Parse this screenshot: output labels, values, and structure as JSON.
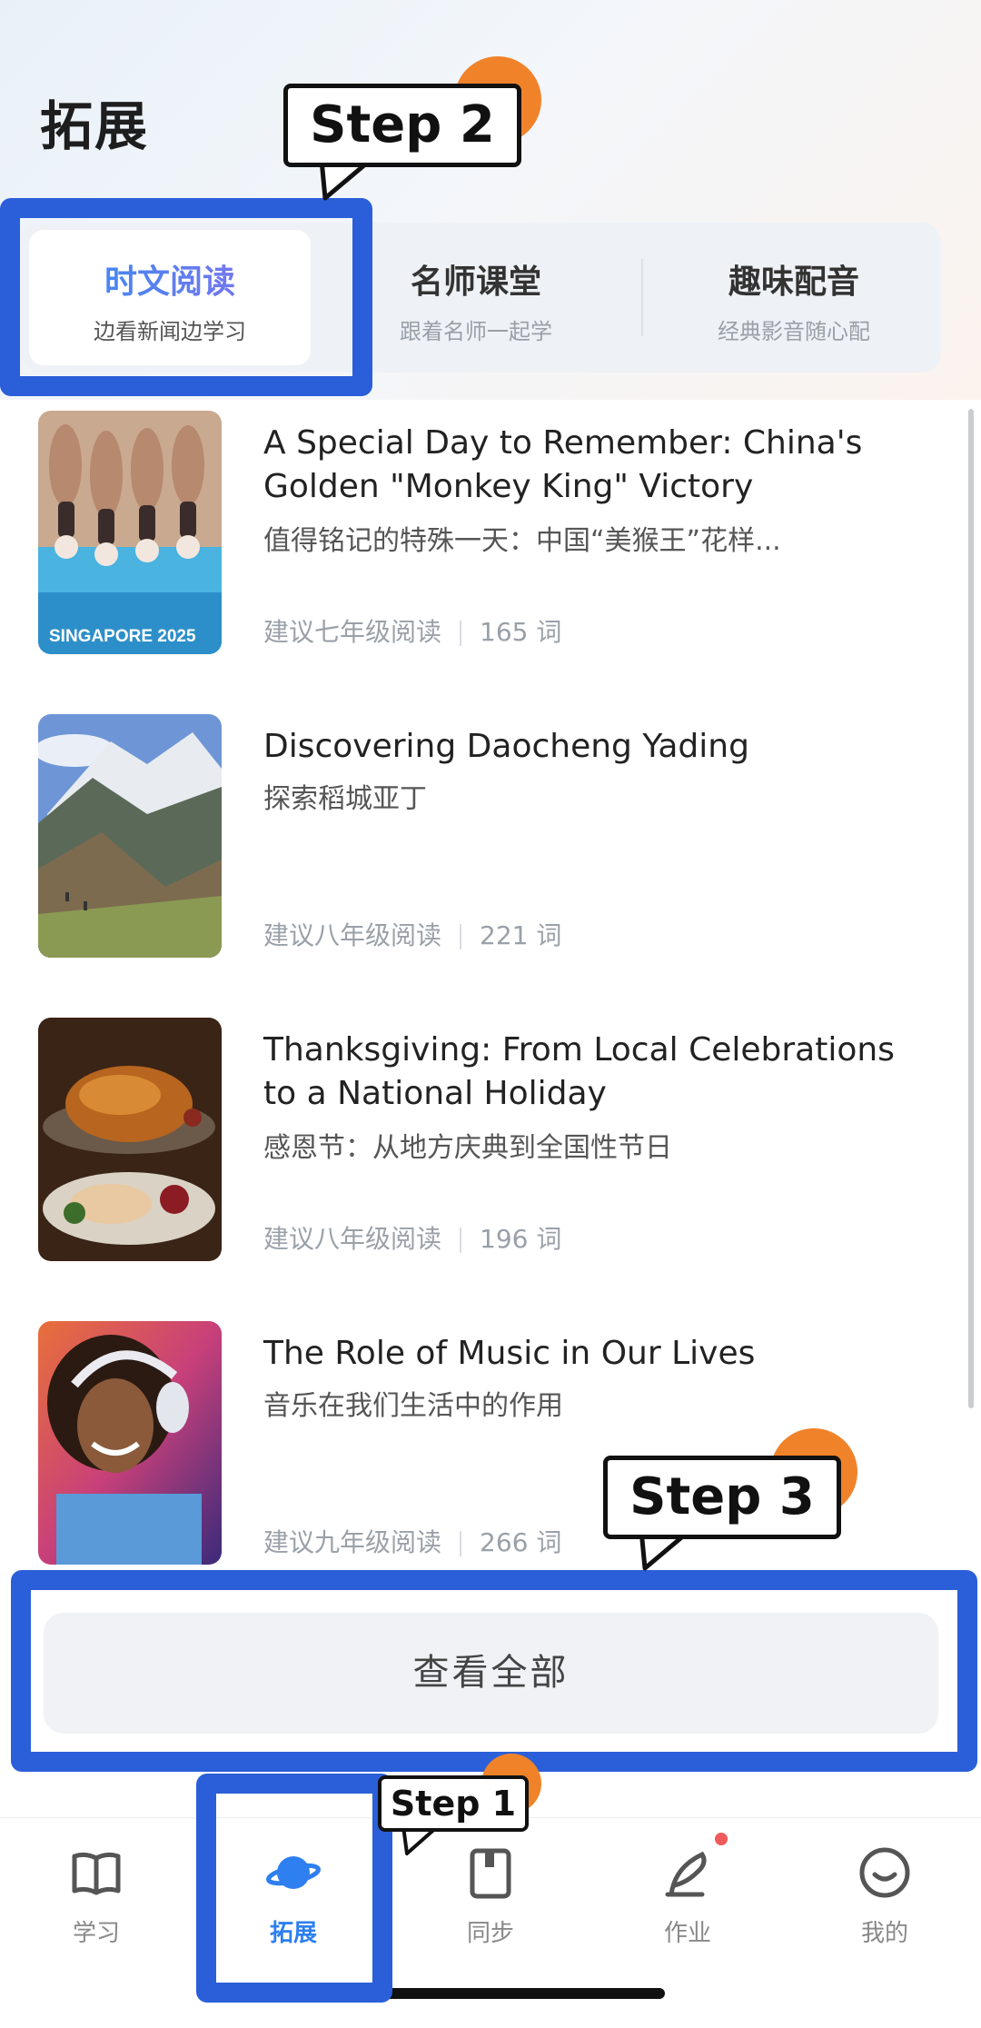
{
  "header": {
    "title": "拓展"
  },
  "tabs": [
    {
      "label": "时文阅读",
      "sub": "边看新闻边学习",
      "active": true
    },
    {
      "label": "名师课堂",
      "sub": "跟着名师一起学",
      "active": false
    },
    {
      "label": "趣味配音",
      "sub": "经典影音随心配",
      "active": false
    }
  ],
  "articles": [
    {
      "title": "A Special Day to Remember: China's Golden \"Monkey King\" Victory",
      "subtitle": "值得铭记的特殊一天：中国“美猴王”花样...",
      "grade": "建议七年级阅读",
      "words": "165 词",
      "thumb_text": "SINGAPORE 2025"
    },
    {
      "title": "Discovering Daocheng Yading",
      "subtitle": "探索稻城亚丁",
      "grade": "建议八年级阅读",
      "words": "221 词"
    },
    {
      "title": "Thanksgiving: From Local Celebrations to a National Holiday",
      "subtitle": "感恩节：从地方庆典到全国性节日",
      "grade": "建议八年级阅读",
      "words": "196 词"
    },
    {
      "title": "The Role of Music in Our Lives",
      "subtitle": "音乐在我们生活中的作用",
      "grade": "建议九年级阅读",
      "words": "266 词"
    }
  ],
  "view_all_label": "查看全部",
  "nav": [
    {
      "label": "学习",
      "icon": "book-icon",
      "active": false
    },
    {
      "label": "拓展",
      "icon": "planet-icon",
      "active": true
    },
    {
      "label": "同步",
      "icon": "notebook-icon",
      "active": false
    },
    {
      "label": "作业",
      "icon": "pen-icon",
      "active": false,
      "badge": true
    },
    {
      "label": "我的",
      "icon": "smiley-icon",
      "active": false
    }
  ],
  "annotations": {
    "step1": "Step 1",
    "step2": "Step 2",
    "step3": "Step 3"
  },
  "colors": {
    "highlight": "#2b5fd9",
    "accent": "#2e7fef",
    "step_dot": "#f0832a",
    "badge": "#f05a5a"
  }
}
